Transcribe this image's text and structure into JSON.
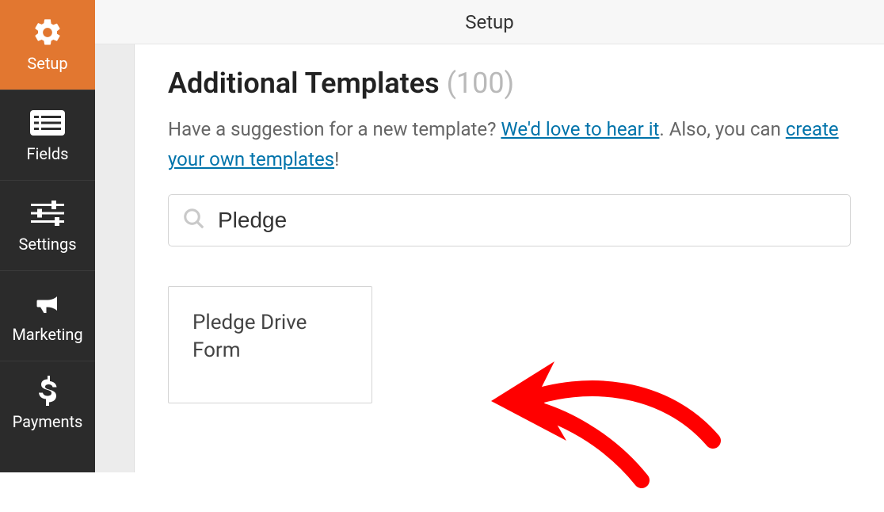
{
  "sidebar": {
    "items": [
      {
        "label": "Setup",
        "icon": "gear"
      },
      {
        "label": "Fields",
        "icon": "list"
      },
      {
        "label": "Settings",
        "icon": "sliders"
      },
      {
        "label": "Marketing",
        "icon": "megaphone"
      },
      {
        "label": "Payments",
        "icon": "dollar"
      }
    ]
  },
  "header": {
    "title": "Setup"
  },
  "templates": {
    "heading": "Additional Templates",
    "count": "(100)",
    "subtext_prefix": "Have a suggestion for a new template? ",
    "link1": "We'd love to hear it",
    "subtext_mid": ". Also, you can ",
    "link2": "create your own templates",
    "subtext_suffix": "!",
    "search_value": "Pledge",
    "results": [
      {
        "title": "Pledge Drive Form"
      }
    ]
  }
}
